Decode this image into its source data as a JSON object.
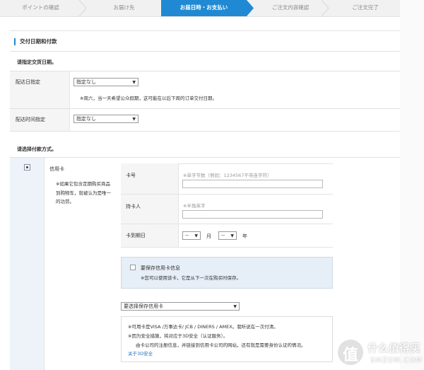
{
  "steps": [
    {
      "label": "ポイントの確認",
      "active": false
    },
    {
      "label": "お届け先",
      "active": false
    },
    {
      "label": "お届日時・お支払い",
      "active": true
    },
    {
      "label": "ご注文内容確認",
      "active": false
    },
    {
      "label": "ご注文完了",
      "active": false
    }
  ],
  "section": {
    "title": "交付日期和付款"
  },
  "delivery": {
    "heading": "请指定交货日期。",
    "date_label": "配达日指定",
    "date_value": "指定なし",
    "date_note": "※周六，当一天希望公众假期，这可能在以后下周的订单交付日期。",
    "time_label": "配达时间指定",
    "time_value": "指定なし"
  },
  "payment": {
    "heading": "请选择付款方式。",
    "method_label": "信用卡",
    "method_note": "※如果它包含定期购买商品到购物车，就被认为是唯一的功劳。",
    "card_number_label": "卡号",
    "card_number_hint": "※单字节数（例如：1234567不带连字符）",
    "holder_label": "持卡人",
    "holder_hint": "※半角英字",
    "expiry_label": "卡到期日",
    "expiry_month_value": "--",
    "expiry_month_unit": "月",
    "expiry_year_value": "--",
    "expiry_year_unit": "年",
    "save_label": "要保存信用卡信息",
    "save_note": "※您可以使用该卡，它是从下一次在购买时保存。",
    "saved_select": "要选择保存信用卡",
    "info_line1": "※可用卡是VISA /万事达卡/ JCB / DINERS / AMEX。我听说在一次付清。",
    "info_line2": "※因为安全措施，将对应于3D安全（认证服务）。",
    "info_line3": "由卡公司的注册信息，并链接到信用卡公司的网站，还有就是需要身份认证的情况。",
    "info_link": "关于3D安全"
  },
  "watermark": {
    "title": "什么值得买",
    "url": "SMZDM.COM"
  },
  "colors": {
    "accent": "#1f8ad3",
    "panel": "#e6eef7"
  }
}
